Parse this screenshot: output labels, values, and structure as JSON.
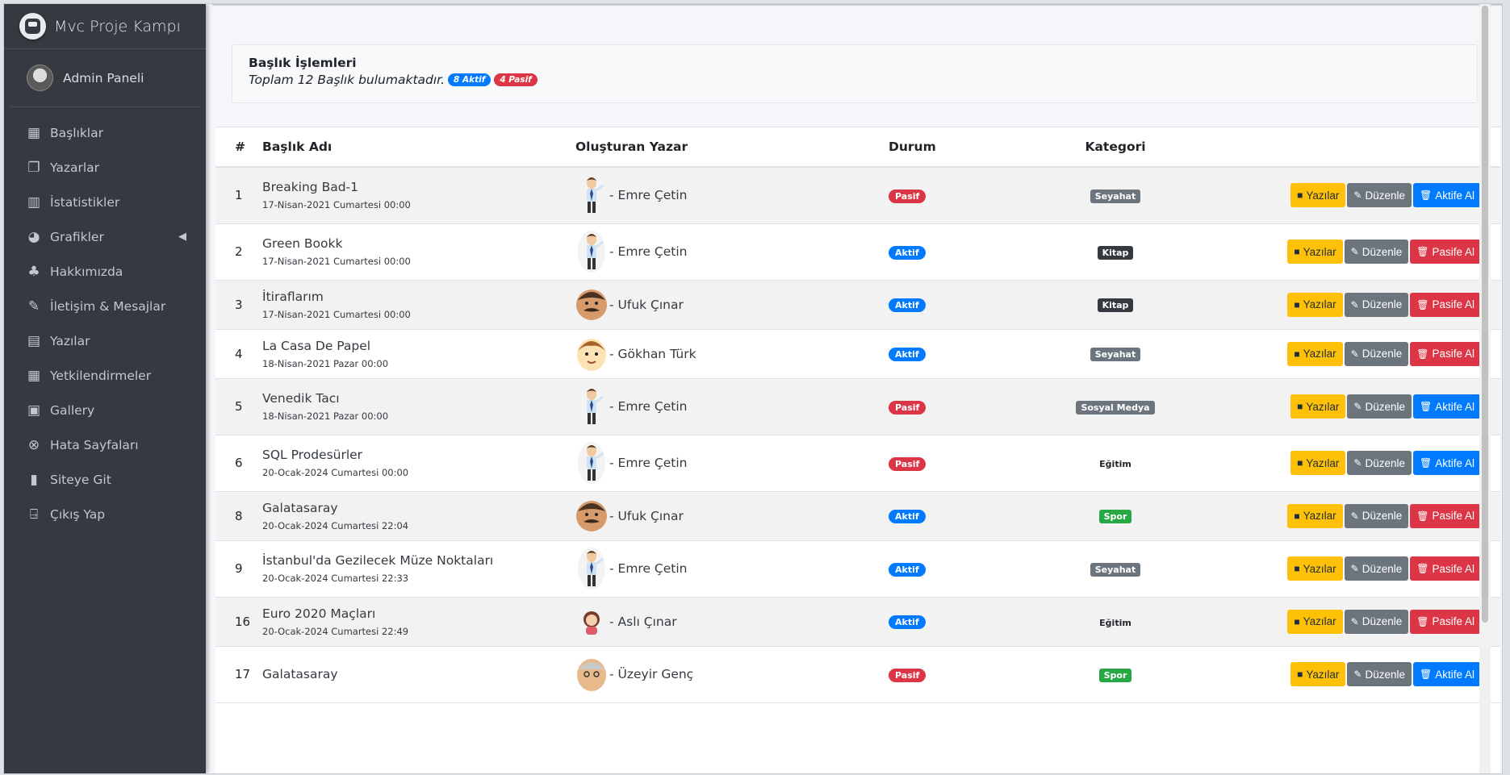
{
  "brand": {
    "title": "Mvc Proje Kampı"
  },
  "user": {
    "name": "Admin Paneli"
  },
  "sidebar": {
    "items": [
      {
        "label": "Başlıklar",
        "icon": "grid-icon",
        "glyph": "▦"
      },
      {
        "label": "Yazarlar",
        "icon": "copy-icon",
        "glyph": "❐"
      },
      {
        "label": "İstatistikler",
        "icon": "bar-chart-icon",
        "glyph": "▥"
      },
      {
        "label": "Grafikler",
        "icon": "pie-chart-icon",
        "glyph": "◕",
        "caret": "◀"
      },
      {
        "label": "Hakkımızda",
        "icon": "tree-icon",
        "glyph": "♣"
      },
      {
        "label": "İletişim & Mesajlar",
        "icon": "edit-icon",
        "glyph": "✎"
      },
      {
        "label": "Yazılar",
        "icon": "table-icon",
        "glyph": "▤"
      },
      {
        "label": "Yetkilendirmeler",
        "icon": "calendar-icon",
        "glyph": "▦"
      },
      {
        "label": "Gallery",
        "icon": "image-icon",
        "glyph": "▣"
      },
      {
        "label": "Hata Sayfaları",
        "icon": "times-circle-icon",
        "glyph": "⊗"
      },
      {
        "label": "Siteye Git",
        "icon": "book-icon",
        "glyph": "▮"
      },
      {
        "label": "Çıkış Yap",
        "icon": "door-exit-icon",
        "glyph": "⍈"
      }
    ]
  },
  "callout": {
    "title": "Başlık İşlemleri",
    "summary": "Toplam 12 Başlık bulumaktadır.",
    "active_badge": "8 Aktif",
    "passive_badge": "4 Pasif"
  },
  "table": {
    "headers": {
      "num": "#",
      "title": "Başlık Adı",
      "author": "Oluşturan Yazar",
      "status": "Durum",
      "category": "Kategori"
    },
    "actions": {
      "posts": "Yazılar",
      "edit": "Düzenle",
      "activate": "Aktife Al",
      "deactivate": "Pasife Al"
    },
    "rows": [
      {
        "num": "1",
        "title": "Breaking Bad-1",
        "date": "17-Nisan-2021 Cumartesi 00:00",
        "author": "- Emre Çetin",
        "avatar": "man-tie",
        "status": "Pasif",
        "category": "Seyahat",
        "cat_style": "gray"
      },
      {
        "num": "2",
        "title": "Green Bookk",
        "date": "17-Nisan-2021 Cumartesi 00:00",
        "author": "- Emre Çetin",
        "avatar": "man-tie",
        "status": "Aktif",
        "category": "Kitap",
        "cat_style": "dark"
      },
      {
        "num": "3",
        "title": "İtiraflarım",
        "date": "17-Nisan-2021 Cumartesi 00:00",
        "author": "- Ufuk Çınar",
        "avatar": "mustache",
        "status": "Aktif",
        "category": "Kitap",
        "cat_style": "dark"
      },
      {
        "num": "4",
        "title": "La Casa De Papel",
        "date": "18-Nisan-2021 Pazar 00:00",
        "author": "- Gökhan Türk",
        "avatar": "boy",
        "status": "Aktif",
        "category": "Seyahat",
        "cat_style": "gray"
      },
      {
        "num": "5",
        "title": "Venedik Tacı",
        "date": "18-Nisan-2021 Pazar 00:00",
        "author": "- Emre Çetin",
        "avatar": "man-tie",
        "status": "Pasif",
        "category": "Sosyal Medya",
        "cat_style": "gray"
      },
      {
        "num": "6",
        "title": "SQL Prodesürler",
        "date": "20-Ocak-2024 Cumartesi 00:00",
        "author": "- Emre Çetin",
        "avatar": "man-tie",
        "status": "Pasif",
        "category": "Eğitim",
        "cat_style": "plain"
      },
      {
        "num": "8",
        "title": "Galatasaray",
        "date": "20-Ocak-2024 Cumartesi 22:04",
        "author": "- Ufuk Çınar",
        "avatar": "mustache",
        "status": "Aktif",
        "category": "Spor",
        "cat_style": "green"
      },
      {
        "num": "9",
        "title": "İstanbul'da Gezilecek Müze Noktaları",
        "date": "20-Ocak-2024 Cumartesi 22:33",
        "author": "- Emre Çetin",
        "avatar": "man-tie",
        "status": "Aktif",
        "category": "Seyahat",
        "cat_style": "gray"
      },
      {
        "num": "16",
        "title": "Euro 2020 Maçları",
        "date": "20-Ocak-2024 Cumartesi 22:49",
        "author": "- Aslı Çınar",
        "avatar": "woman",
        "status": "Aktif",
        "category": "Eğitim",
        "cat_style": "plain"
      },
      {
        "num": "17",
        "title": "Galatasaray",
        "date": "",
        "author": "- Üzeyir Genç",
        "avatar": "old-man",
        "status": "Pasif",
        "category": "Spor",
        "cat_style": "green"
      }
    ]
  }
}
